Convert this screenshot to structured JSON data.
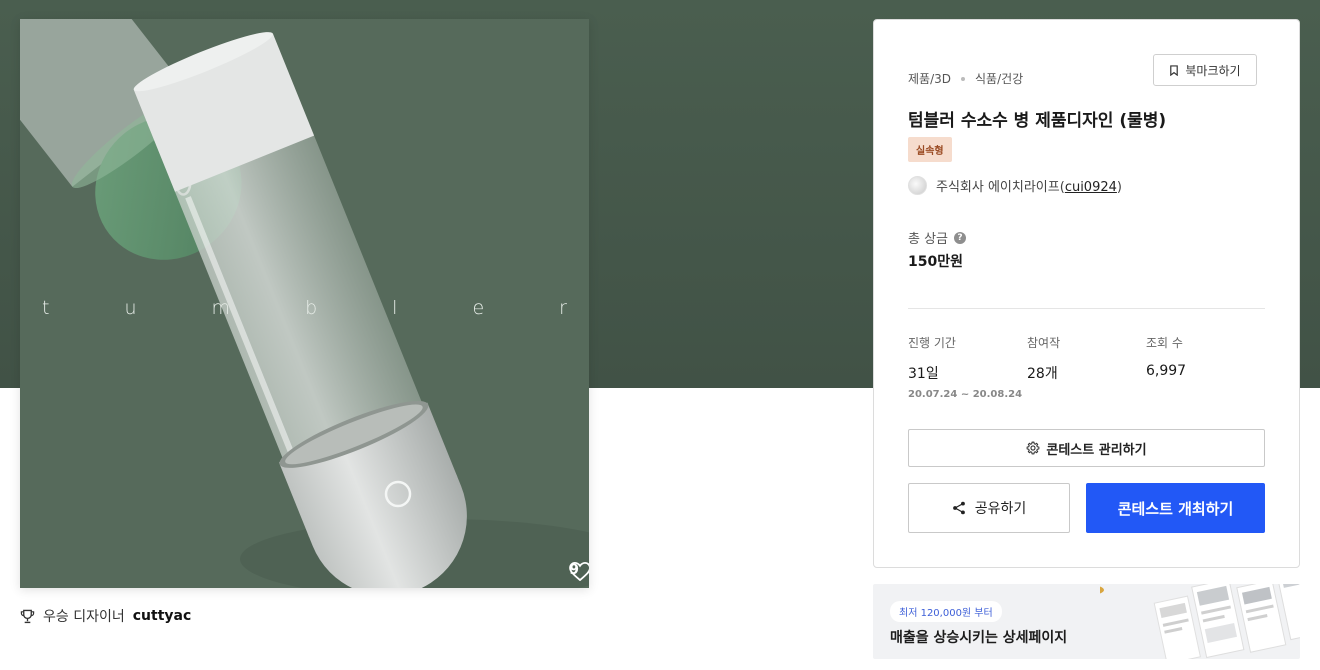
{
  "product": {
    "image_word_letters": [
      "t",
      "u",
      "m",
      "b",
      "l",
      "e",
      "r"
    ],
    "like_count": "9"
  },
  "winner": {
    "label": "우승 디자이너",
    "name": "cuttyac"
  },
  "card": {
    "breadcrumb": [
      "제품/3D",
      "식품/건강"
    ],
    "bookmark_label": "북마크하기",
    "title": "텀블러 수소수 병 제품디자인 (물병)",
    "badge": "실속형",
    "host": {
      "name": "주식회사 에이치라이프",
      "handle_open": "(",
      "handle": "cui0924",
      "handle_close": ")"
    },
    "prize": {
      "label": "총 상금",
      "help": "?",
      "value": "150만원"
    },
    "stats": {
      "period_label": "진행 기간",
      "period_value": "31일",
      "period_range": "20.07.24 ~ 20.08.24",
      "entries_label": "참여작",
      "entries_value": "28개",
      "views_label": "조회 수",
      "views_value": "6,997"
    },
    "manage_label": "콘테스트 관리하기",
    "share_label": "공유하기",
    "host_contest_label": "콘테스트 개최하기"
  },
  "ad": {
    "chip": "최저 120,000원 부터",
    "headline": "매출을 상승시키는 상세페이지"
  },
  "colors": {
    "hero_bg": "#455749",
    "image_bg": "#566a5b",
    "primary": "#2258f6",
    "badge_bg": "#f6dccd",
    "badge_text": "#9a4a22"
  },
  "icons": [
    "heart-icon",
    "trophy-icon",
    "bookmark-icon",
    "help-icon",
    "gear-icon",
    "share-icon"
  ]
}
